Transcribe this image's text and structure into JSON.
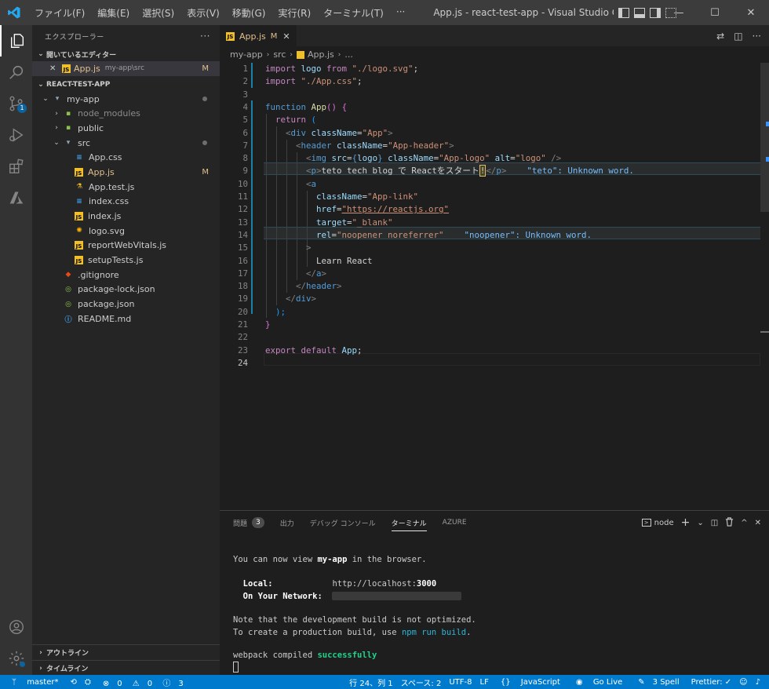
{
  "titlebar": {
    "menu": [
      "ファイル(F)",
      "編集(E)",
      "選択(S)",
      "表示(V)",
      "移動(G)",
      "実行(R)",
      "ターミナル(T)",
      "···"
    ],
    "title": "App.js - react-test-app - Visual Studio Code",
    "minimize": "—",
    "maximize": "☐",
    "close": "✕"
  },
  "activity_badge": "1",
  "sidebar": {
    "title": "エクスプローラー",
    "more": "···",
    "open_editors": {
      "header": "開いているエディター",
      "items": [
        {
          "close": "✕",
          "name": "App.js",
          "path": "my-app\\src",
          "status": "M"
        }
      ]
    },
    "project": {
      "header": "REACT-TEST-APP",
      "items": [
        {
          "name": "my-app",
          "type": "folder-open"
        },
        {
          "name": "node_modules",
          "type": "folder"
        },
        {
          "name": "public",
          "type": "folder"
        },
        {
          "name": "src",
          "type": "folder-open"
        },
        {
          "name": "App.css",
          "type": "css"
        },
        {
          "name": "App.js",
          "type": "js",
          "status": "M"
        },
        {
          "name": "App.test.js",
          "type": "test"
        },
        {
          "name": "index.css",
          "type": "css"
        },
        {
          "name": "index.js",
          "type": "js"
        },
        {
          "name": "logo.svg",
          "type": "svg"
        },
        {
          "name": "reportWebVitals.js",
          "type": "js"
        },
        {
          "name": "setupTests.js",
          "type": "js"
        },
        {
          "name": ".gitignore",
          "type": "git"
        },
        {
          "name": "package-lock.json",
          "type": "json"
        },
        {
          "name": "package.json",
          "type": "json"
        },
        {
          "name": "README.md",
          "type": "info"
        }
      ]
    },
    "outline": "アウトライン",
    "timeline": "タイムライン"
  },
  "tab": {
    "name": "App.js",
    "status": "M",
    "close": "✕"
  },
  "breadcrumb": [
    "my-app",
    "src",
    "App.js",
    "..."
  ],
  "editor": {
    "line_numbers": [
      "1",
      "2",
      "3",
      "4",
      "5",
      "6",
      "7",
      "8",
      "9",
      "10",
      "11",
      "12",
      "13",
      "14",
      "15",
      "16",
      "17",
      "18",
      "19",
      "20",
      "21",
      "22",
      "23",
      "24"
    ],
    "lines": {
      "l1": {
        "kw": "import",
        "id": " logo ",
        "kw2": "from",
        "str": " \"./logo.svg\"",
        "end": ";"
      },
      "l2": {
        "kw": "import",
        "str": " \"./App.css\"",
        "end": ";"
      },
      "l4": {
        "kw": "function",
        "fn": " App",
        "p": "()",
        "sp": " ",
        "b": "{"
      },
      "l5": {
        "kw": "return",
        "b": " ("
      },
      "l6": {
        "o": "<",
        "tag": "div",
        "attr": " className",
        "eq": "=",
        "str": "\"App\"",
        "c": ">"
      },
      "l7": {
        "o": "<",
        "tag": "header",
        "attr": " className",
        "eq": "=",
        "str": "\"App-header\"",
        "c": ">"
      },
      "l8": {
        "o": "<",
        "tag": "img",
        "attr": " src",
        "eq": "=",
        "b1": "{",
        "v": "logo",
        "b2": "}",
        "attr2": " className",
        "eq2": "=",
        "str": "\"App-logo\"",
        "attr3": " alt",
        "eq3": "=",
        "str2": "\"logo\"",
        "c": " />"
      },
      "l9": {
        "o": "<",
        "tag": "p",
        "c": ">",
        "txt": "teto tech blog で Reactをスタート",
        "bang": "!",
        "o2": "</",
        "tag2": "p",
        "c2": ">",
        "diag": "    \"teto\": Unknown word."
      },
      "l10": {
        "o": "<",
        "tag": "a"
      },
      "l11": {
        "attr": "className",
        "eq": "=",
        "str": "\"App-link\""
      },
      "l12": {
        "attr": "href",
        "eq": "=",
        "str": "\"https://reactjs.org\""
      },
      "l13": {
        "attr": "target",
        "eq": "=",
        "str": "\"_blank\""
      },
      "l14": {
        "attr": "rel",
        "eq": "=",
        "str": "\"noopener noreferrer\"",
        "diag": "    \"noopener\": Unknown word."
      },
      "l15": {
        "c": ">"
      },
      "l16": {
        "txt": "Learn React"
      },
      "l17": {
        "o": "</",
        "tag": "a",
        "c": ">"
      },
      "l18": {
        "o": "</",
        "tag": "header",
        "c": ">"
      },
      "l19": {
        "o": "</",
        "tag": "div",
        "c": ">"
      },
      "l20": {
        "b": ");"
      },
      "l21": {
        "b": "}"
      },
      "l23": {
        "kw": "export",
        "kw2": " default",
        "id": " App",
        "end": ";"
      }
    }
  },
  "panel": {
    "tabs": [
      "問題",
      "出力",
      "デバッグ コンソール",
      "ターミナル",
      "AZURE"
    ],
    "problems_count": "3",
    "terminal_name": "node",
    "actions": [
      "+",
      "⌄",
      "◫",
      "🗑",
      "^",
      "✕"
    ],
    "terminal": {
      "line1_a": "You can now view ",
      "line1_b": "my-app",
      "line1_c": " in the browser.",
      "local_label": "  Local:",
      "local_pad": "            ",
      "local_url": "http://localhost:",
      "local_port": "3000",
      "network_label": "  On Your Network:",
      "note1": "Note that the development build is not optimized.",
      "note2_a": "To create a production build, use ",
      "note2_b": "npm run build",
      "note2_c": ".",
      "compiled_a": "webpack compiled ",
      "compiled_b": "successfully"
    }
  },
  "statusbar": {
    "branch": "master*",
    "errors": "0",
    "warnings": "0",
    "infos": "3",
    "position": "行 24、列 1",
    "spaces": "スペース: 2",
    "encoding": "UTF-8",
    "eol": "LF",
    "language": "JavaScript",
    "golive": "Go Live",
    "spell": "3 Spell",
    "prettier": "Prettier: ✓"
  },
  "colors": {
    "statusbar": "#007acc",
    "accent": "#0e639c",
    "modified": "#e2c08d"
  }
}
